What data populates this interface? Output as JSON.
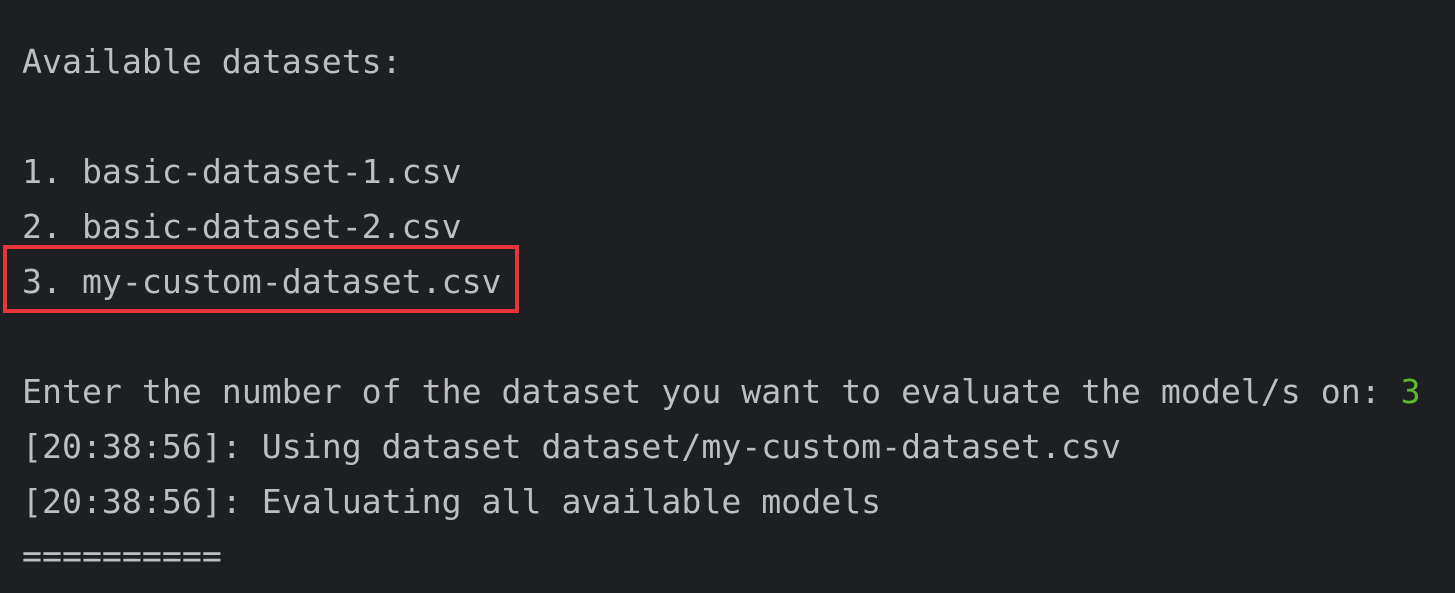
{
  "terminal": {
    "heading": "Available datasets:",
    "datasets": [
      {
        "label": "1. basic-dataset-1.csv"
      },
      {
        "label": "2. basic-dataset-2.csv"
      },
      {
        "label": "3. my-custom-dataset.csv"
      }
    ],
    "prompt": "Enter the number of the dataset you want to evaluate the model/s on: ",
    "user_input": "3",
    "log_lines": [
      "[20:38:56]: Using dataset dataset/my-custom-dataset.csv",
      "[20:38:56]: Evaluating all available models"
    ],
    "separator": "=========="
  },
  "colors": {
    "background": "#1e1f22",
    "text": "#bcbec4",
    "input": "#5fb832",
    "highlight": "#e5343d"
  }
}
